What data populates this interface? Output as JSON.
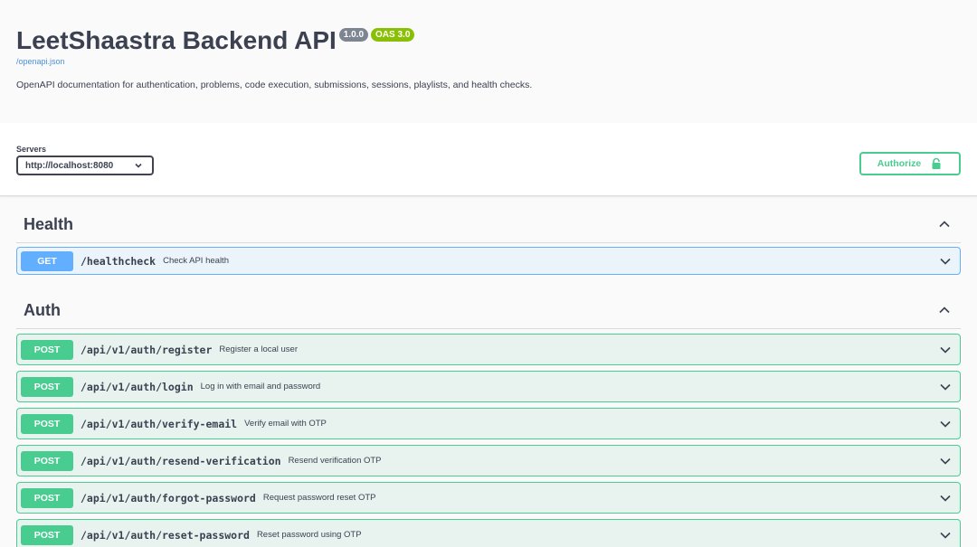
{
  "info": {
    "title": "LeetShaastra Backend API",
    "version": "1.0.0",
    "oas": "OAS 3.0",
    "spec_link": "/openapi.json",
    "description": "OpenAPI documentation for authentication, problems, code execution, submissions, sessions, playlists, and health checks."
  },
  "servers": {
    "label": "Servers",
    "selected": "http://localhost:8080"
  },
  "authorize": {
    "label": "Authorize"
  },
  "tags": {
    "health": {
      "name": "Health",
      "operations": [
        {
          "method": "GET",
          "path": "/healthcheck",
          "summary": "Check API health"
        }
      ]
    },
    "auth": {
      "name": "Auth",
      "operations": [
        {
          "method": "POST",
          "path": "/api/v1/auth/register",
          "summary": "Register a local user"
        },
        {
          "method": "POST",
          "path": "/api/v1/auth/login",
          "summary": "Log in with email and password"
        },
        {
          "method": "POST",
          "path": "/api/v1/auth/verify-email",
          "summary": "Verify email with OTP"
        },
        {
          "method": "POST",
          "path": "/api/v1/auth/resend-verification",
          "summary": "Resend verification OTP"
        },
        {
          "method": "POST",
          "path": "/api/v1/auth/forgot-password",
          "summary": "Request password reset OTP"
        },
        {
          "method": "POST",
          "path": "/api/v1/auth/reset-password",
          "summary": "Reset password using OTP"
        }
      ]
    }
  },
  "colors": {
    "get": "#61affe",
    "post": "#49cc90",
    "authorize": "#49cc90",
    "version_badge": "#7d8492",
    "oas_badge": "#89bf04",
    "link": "#4990e2"
  },
  "icons": {
    "server_dropdown": "chevron-down-icon",
    "authorize": "lock-icon",
    "tag_toggle": "chevron-up-icon",
    "operation_toggle": "chevron-down-icon"
  }
}
